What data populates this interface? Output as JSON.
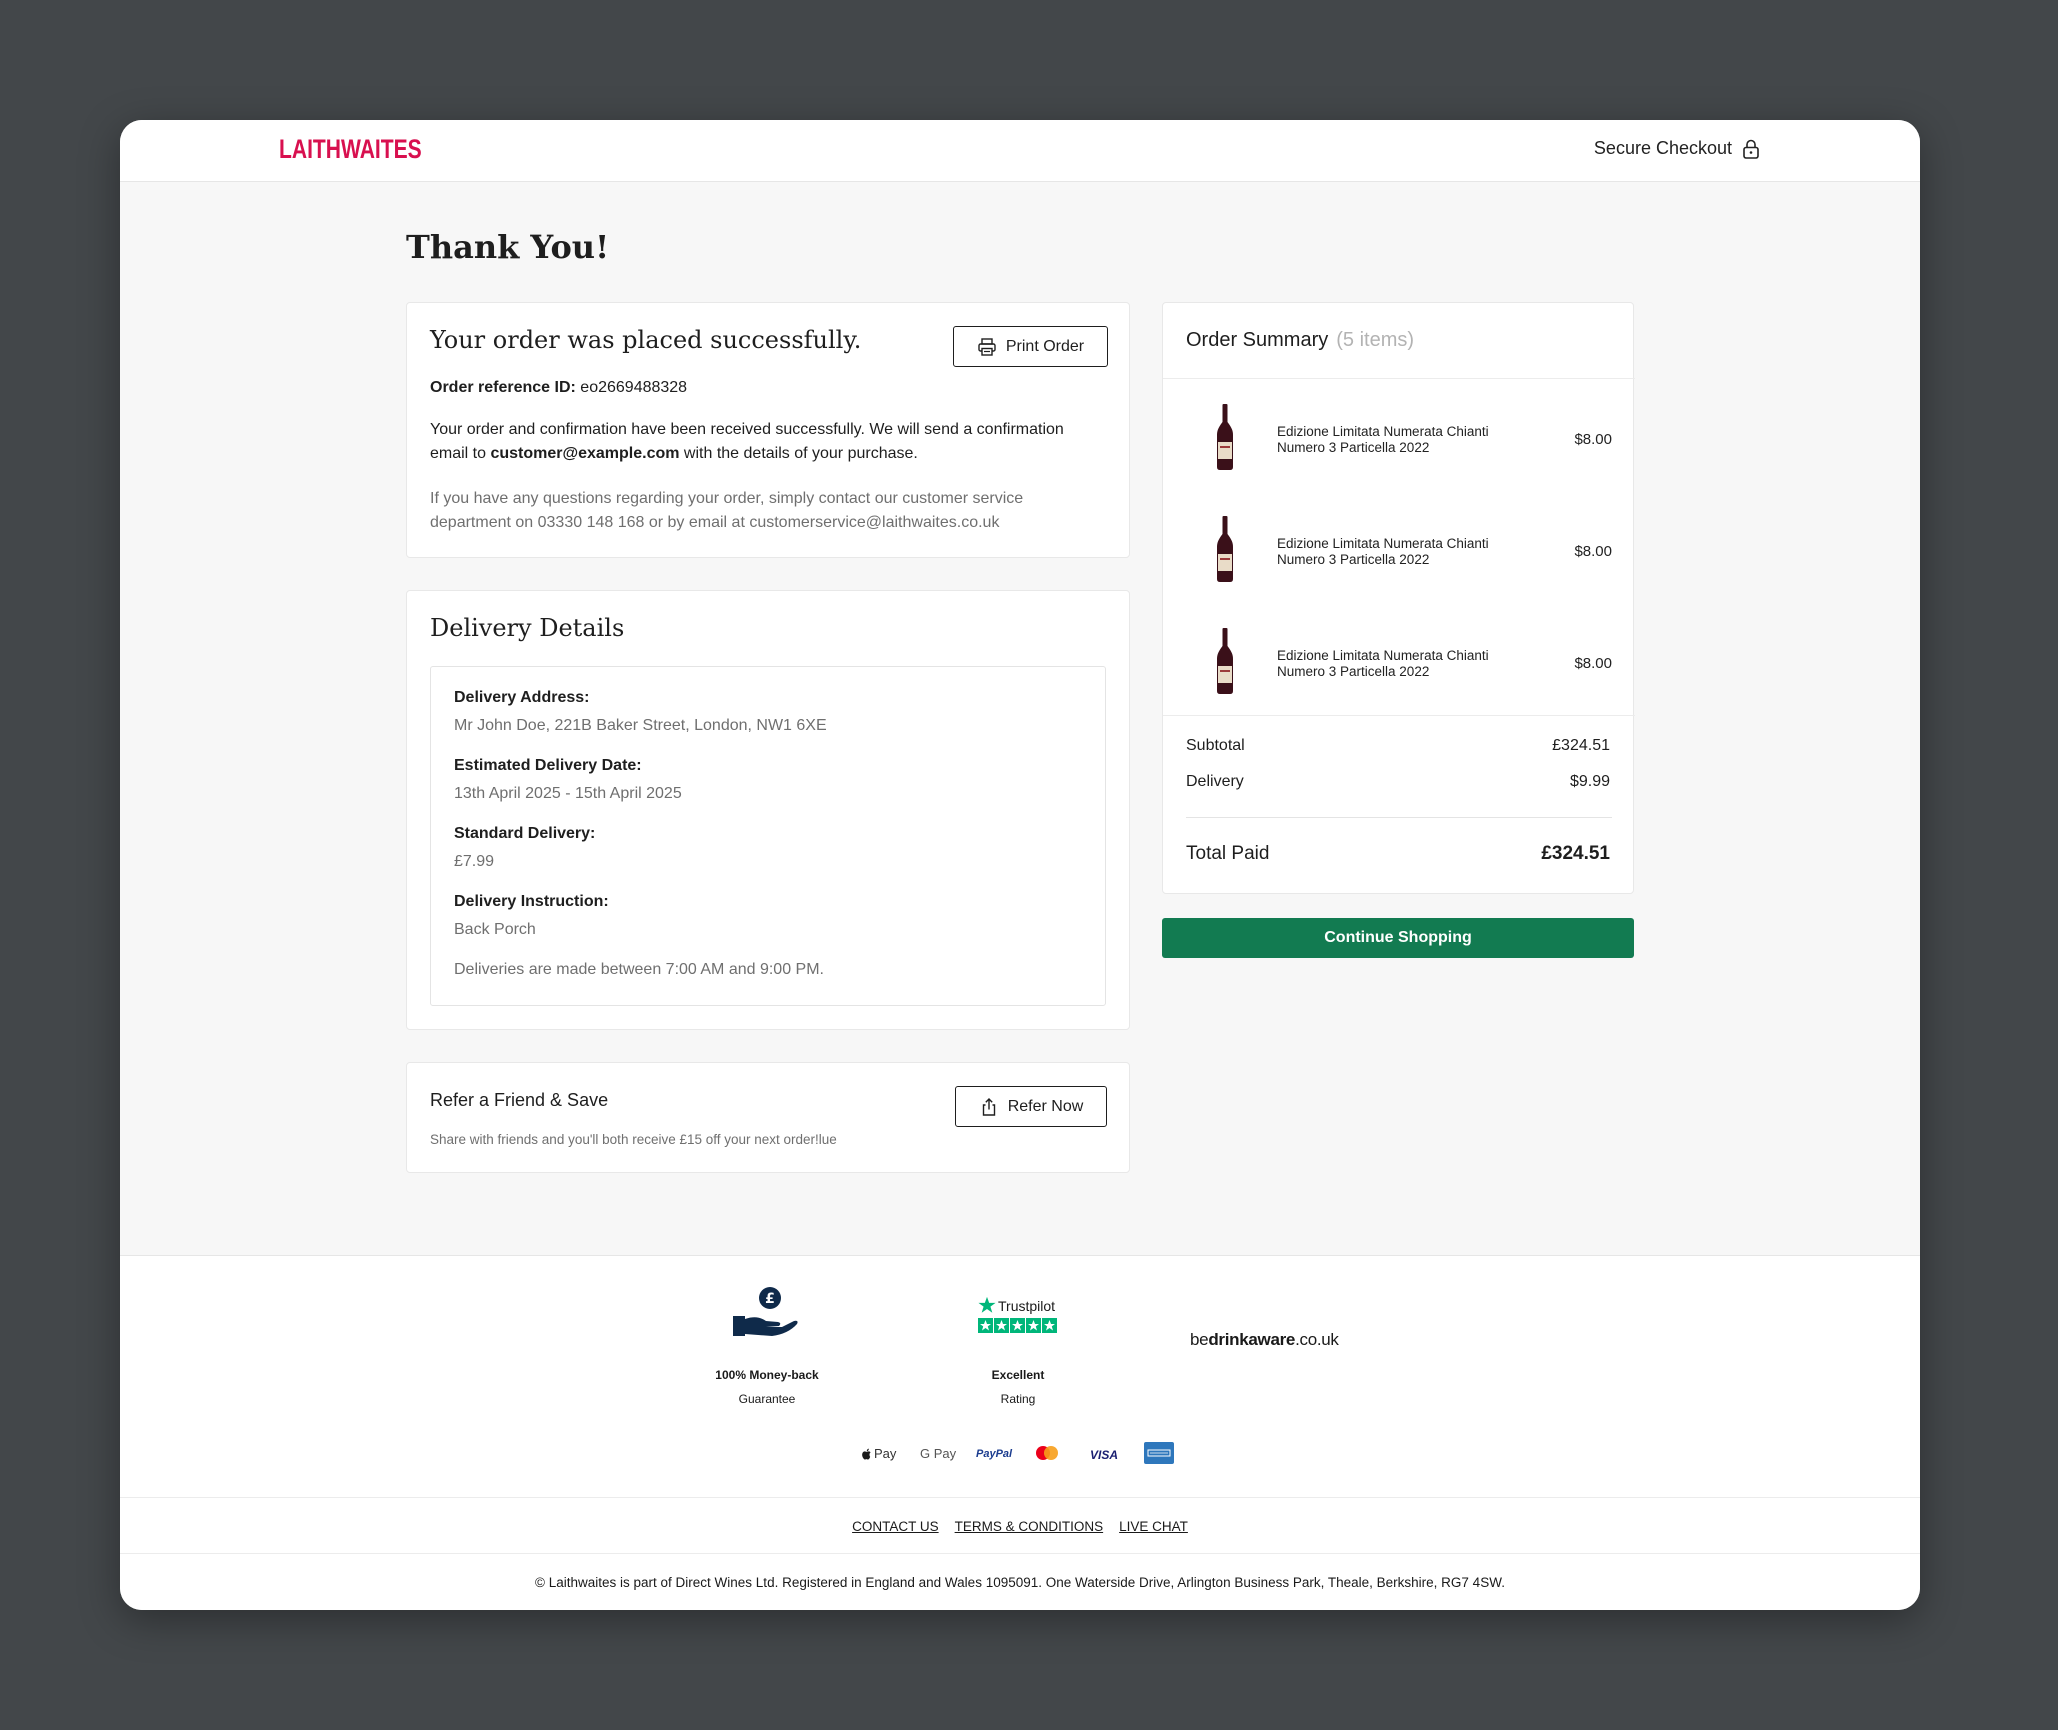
{
  "header": {
    "logo": "LAITHWAITES",
    "secure_checkout": "Secure Checkout"
  },
  "page_title": "Thank You!",
  "confirmation": {
    "heading": "Your order was placed successfully.",
    "print_label": "Print Order",
    "ref_label": "Order reference ID:",
    "ref_value": "eo2669488328",
    "msg_part1": "Your order and confirmation have been received successfully. We will send a confirmation",
    "msg_part2_prefix": "email to ",
    "email": "customer@example.com",
    "msg_part2_suffix": " with the details of your purchase.",
    "help_line1": "If you have any questions regarding your order, simply contact our customer service",
    "help_line2": "department on 03330 148 168 or by email at customerservice@laithwaites.co.uk"
  },
  "delivery": {
    "heading": "Delivery Details",
    "address_label": "Delivery Address:",
    "address_value": "Mr John Doe, 221B Baker Street, London, NW1 6XE",
    "date_label": "Estimated Delivery Date:",
    "date_value": "13th April 2025 - 15th April 2025",
    "standard_label": "Standard Delivery:",
    "standard_value": "£7.99",
    "instruction_label": "Delivery Instruction:",
    "instruction_value": "Back Porch",
    "hours_note": "Deliveries are made between 7:00 AM and 9:00 PM."
  },
  "refer": {
    "heading": "Refer a Friend & Save",
    "button": "Refer Now",
    "note": "Share with friends and you'll both receive £15 off your next order!lue"
  },
  "order_summary": {
    "title": "Order Summary",
    "count": "(5 items)",
    "items": [
      {
        "name_line1": "Edizione Limitata Numerata Chianti",
        "name_line2": "Numero 3 Particella 2022",
        "price": "$8.00"
      },
      {
        "name_line1": "Edizione Limitata Numerata Chianti",
        "name_line2": "Numero 3 Particella 2022",
        "price": "$8.00"
      },
      {
        "name_line1": "Edizione Limitata Numerata Chianti",
        "name_line2": "Numero 3 Particella 2022",
        "price": "$8.00"
      }
    ],
    "subtotal_label": "Subtotal",
    "subtotal_value": "£324.51",
    "delivery_label": "Delivery",
    "delivery_value": "$9.99",
    "total_label": "Total Paid",
    "total_value": "£324.51"
  },
  "continue_label": "Continue Shopping",
  "footer": {
    "money_back_line1": "100% Money-back",
    "money_back_line2": "Guarantee",
    "trustpilot_name": "Trustpilot",
    "trustpilot_line1": "Excellent",
    "trustpilot_line2": "Rating",
    "drinkaware_prefix": "be",
    "drinkaware_bold": "drinkaware",
    "drinkaware_suffix": ".co.uk",
    "payments": [
      "Pay",
      "G Pay",
      "PayPal",
      "VISA"
    ],
    "links": [
      "CONTACT US",
      "TERMS & CONDITIONS",
      "LIVE CHAT"
    ],
    "legal": "© Laithwaites is part of Direct Wines Ltd. Registered in England and Wales 1095091. One Waterside Drive, Arlington Business Park, Theale, Berkshire, RG7 4SW."
  },
  "colors": {
    "brand": "#d8104f",
    "accent_green": "#127b51",
    "trustpilot_green": "#00b67a",
    "navy": "#0f2a4a"
  }
}
